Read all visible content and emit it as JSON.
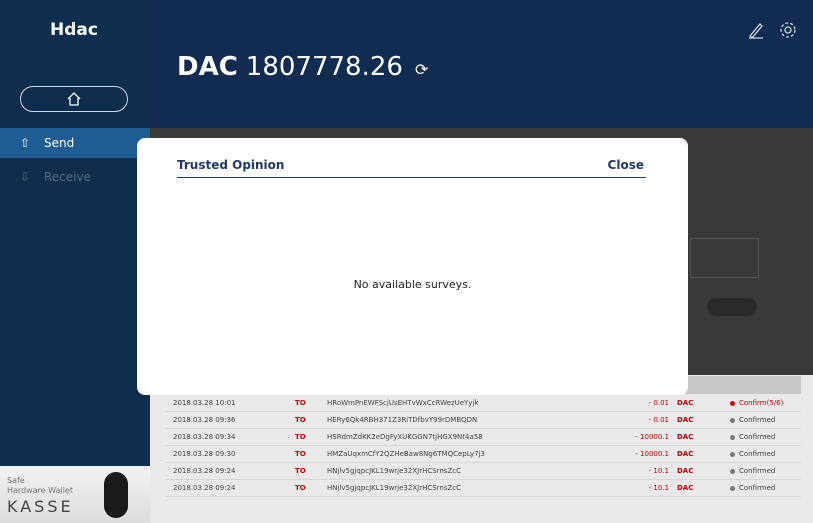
{
  "app": {
    "logo": "Hdac"
  },
  "header": {
    "currency": "DAC",
    "balance": "1807778.26",
    "refresh_glyph": "⟳"
  },
  "sidebar": {
    "items": [
      {
        "label": "Send",
        "icon": "send-icon"
      },
      {
        "label": "Receive",
        "icon": "receive-icon"
      }
    ]
  },
  "modal": {
    "title": "Trusted Opinion",
    "close_label": "Close",
    "message": "No available surveys."
  },
  "promo": {
    "line1": "Safe",
    "line2": "Hardware Wallet",
    "brand": "KASSE"
  },
  "transactions": [
    {
      "date": "2018.03.28 10:01",
      "dir": "TO",
      "address": "HRoWmPnEWFScjUsEHTvWxCcRWezUeYyjk",
      "amount": "- 0.01",
      "currency": "DAC",
      "status": "Confirm(5/6)",
      "pending": true
    },
    {
      "date": "2018.03.28 09:36",
      "dir": "TO",
      "address": "HERy6Qk4RBH371Z3RiTDfbvY99rDMBQDN",
      "amount": "- 0.01",
      "currency": "DAC",
      "status": "Confirmed",
      "pending": false
    },
    {
      "date": "2018.03.28 09:34",
      "dir": "TO",
      "address": "HSRdmZdKK2eDgFyXUKGGN7tjHGX9Nt4a58",
      "amount": "- 10000.1",
      "currency": "DAC",
      "status": "Confirmed",
      "pending": false
    },
    {
      "date": "2018.03.28 09:30",
      "dir": "TO",
      "address": "HMZaUqxmCfY2QZHeBaw8Ng6TMQCepLy7j3",
      "amount": "- 10000.1",
      "currency": "DAC",
      "status": "Confirmed",
      "pending": false
    },
    {
      "date": "2018.03.28 09:24",
      "dir": "TO",
      "address": "HNjlv5gjqpcJKL19wrje32XJrHCSrnsZcC",
      "amount": "- 10.1",
      "currency": "DAC",
      "status": "Confirmed",
      "pending": false
    },
    {
      "date": "2018.03.28 09:24",
      "dir": "TO",
      "address": "HNjlv5gjqpcJKL19wrje32XJrHCSrnsZcC",
      "amount": "- 10.1",
      "currency": "DAC",
      "status": "Confirmed",
      "pending": false
    }
  ],
  "colors": {
    "sidebar": "#0f2d4d",
    "active": "#1e5c94",
    "accent": "#c00000",
    "modal_title": "#1e3a6a"
  }
}
